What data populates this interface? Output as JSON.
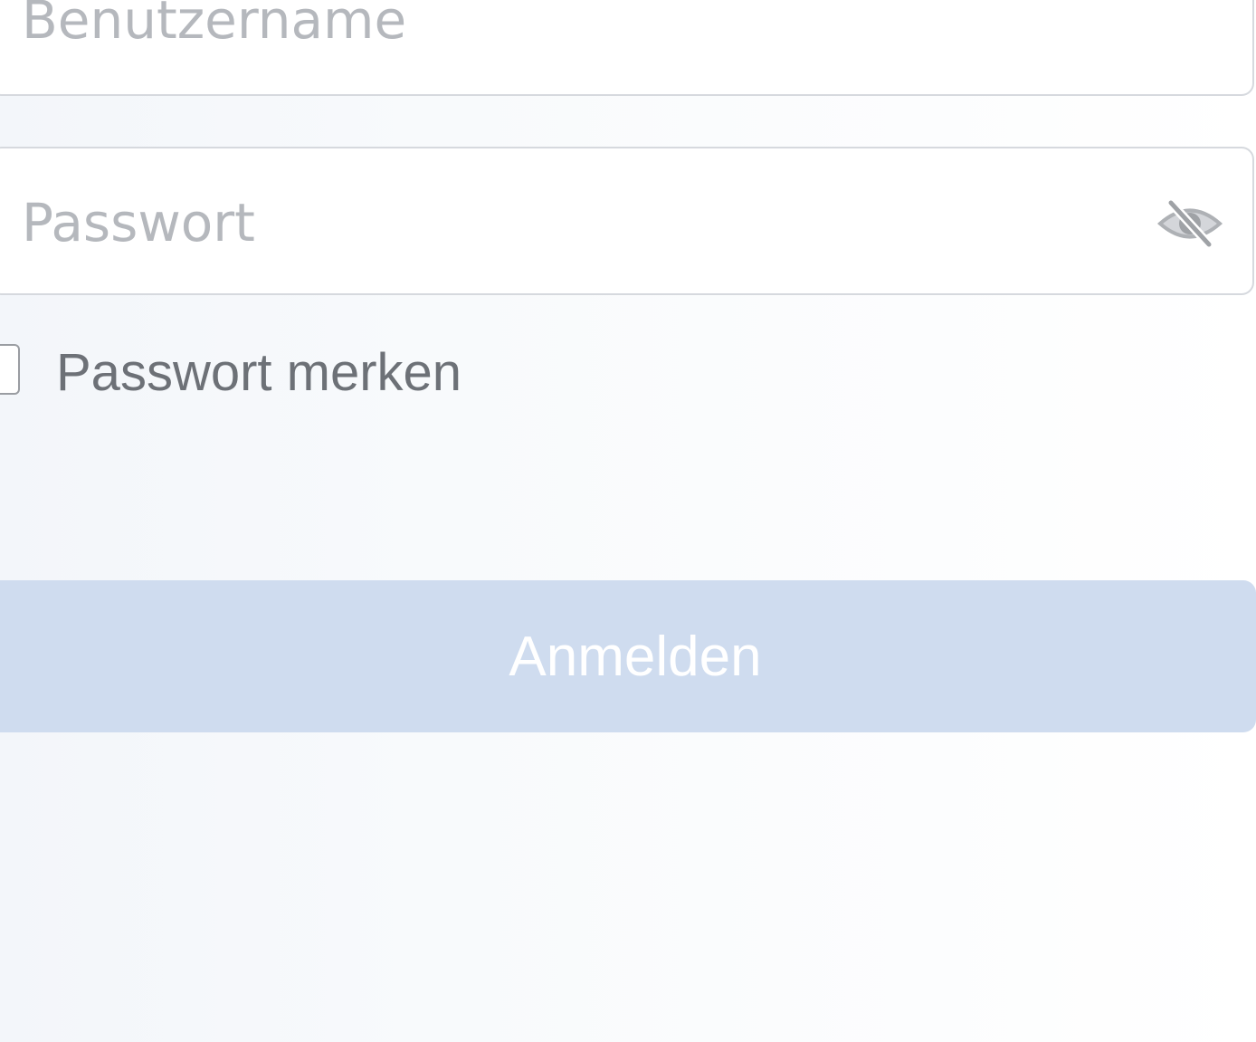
{
  "login_form": {
    "username": {
      "placeholder": "Benutzername",
      "value": ""
    },
    "password": {
      "placeholder": "Passwort",
      "value": "",
      "visibility_icon": "eye-slash-icon"
    },
    "remember": {
      "label": "Passwort merken",
      "checked": false
    },
    "submit": {
      "label": "Anmelden"
    }
  },
  "colors": {
    "button_background": "#cfdcef",
    "button_text": "#ffffff",
    "placeholder_text": "#b5b8bd",
    "label_text": "#6d7177",
    "field_border": "#d6d9de"
  }
}
